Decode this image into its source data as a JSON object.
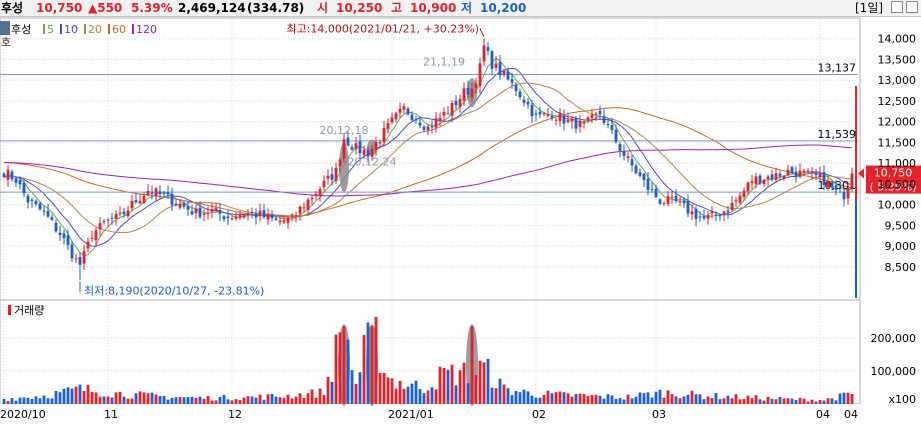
{
  "header": {
    "name": "후성",
    "price": "10,750",
    "change": "▲550",
    "change_pct": "5.39%",
    "volume": "2,469,124",
    "amount": "(334.78)",
    "open_label": "시",
    "open": "10,250",
    "high_label": "고",
    "high": "10,900",
    "low_label": "저",
    "low": "10,200",
    "period": "[1일]"
  },
  "colors": {
    "up": "#e8202a",
    "down": "#1a5fd6",
    "ma5": "#6aa84f",
    "ma10": "#4a4ad6",
    "ma20": "#b8864a",
    "ma60": "#d2691e",
    "ma120": "#a020c0",
    "grid": "#d8d8d8",
    "hline": "#7f96c8",
    "highlight": "#8c8c8c"
  },
  "legend": {
    "ticker": "후성",
    "items": [
      {
        "label": "5",
        "color": "#6aa84f"
      },
      {
        "label": "10",
        "color": "#4a4ad6"
      },
      {
        "label": "20",
        "color": "#b8864a"
      },
      {
        "label": "60",
        "color": "#d2691e"
      },
      {
        "label": "120",
        "color": "#a020c0"
      }
    ]
  },
  "left_tab": "호",
  "volume_title": "거래량",
  "chart_data": {
    "type": "candlestick",
    "price_ticks": [
      "14,000",
      "13,500",
      "13,000",
      "12,500",
      "12,000",
      "11,500",
      "11,000",
      "10,500",
      "10,000",
      "9,500",
      "9,000",
      "8,500"
    ],
    "price_tick_values": [
      14000,
      13500,
      13000,
      12500,
      12000,
      11500,
      11000,
      10500,
      10000,
      9500,
      9000,
      8500
    ],
    "ylim": [
      7750,
      14500
    ],
    "volume_ticks": [
      "200,000",
      "100,000",
      "x100"
    ],
    "volume_tick_values": [
      200000,
      100000
    ],
    "volume_ylim": [
      0,
      260000
    ],
    "x_ticks": [
      "2020/10",
      "11",
      "12",
      "2021/01",
      "02",
      "03",
      "04",
      "04"
    ],
    "x_tick_index": [
      0,
      26,
      57,
      97,
      133,
      163,
      204,
      212
    ],
    "n_days": 213,
    "hlines": [
      13137,
      11539,
      10301
    ],
    "hline_labels": [
      "13,137",
      "11,539",
      "10,301"
    ],
    "current_price": 10750,
    "current_label": "10,750",
    "current_pct_label": "( 5.39%)",
    "high_annotation": "최고:14,000(2021/01/21, +30.23%)",
    "low_annotation": "최저:8,190(2020/10/27, -23.81%)",
    "high_point": {
      "index": 120,
      "price": 14000
    },
    "low_point": {
      "index": 19,
      "price": 8190
    },
    "date_labels": [
      {
        "text": "20,12,18",
        "index": 85,
        "price": 11700
      },
      {
        "text": "20,12,24",
        "index": 92,
        "price": 10950
      },
      {
        "text": "21,1,19",
        "index": 110,
        "price": 13350
      }
    ],
    "highlights": [
      {
        "index": 85,
        "price_top": 11500,
        "price_bottom": 10300
      },
      {
        "index": 92,
        "price_top": 11550,
        "price_bottom": 11200
      },
      {
        "index": 117,
        "price_top": 13050,
        "price_bottom": 12350
      }
    ],
    "volume_highlights": [
      85,
      92,
      117
    ],
    "anchors": [
      [
        0,
        10800
      ],
      [
        3,
        10600
      ],
      [
        6,
        10100
      ],
      [
        10,
        9800
      ],
      [
        14,
        9300
      ],
      [
        19,
        8500
      ],
      [
        22,
        9300
      ],
      [
        26,
        9600
      ],
      [
        29,
        9700
      ],
      [
        33,
        10100
      ],
      [
        36,
        10350
      ],
      [
        40,
        10200
      ],
      [
        44,
        10000
      ],
      [
        48,
        9800
      ],
      [
        52,
        9850
      ],
      [
        56,
        9700
      ],
      [
        60,
        9800
      ],
      [
        64,
        9750
      ],
      [
        68,
        9600
      ],
      [
        72,
        9650
      ],
      [
        74,
        9900
      ],
      [
        77,
        10200
      ],
      [
        80,
        10500
      ],
      [
        83,
        10800
      ],
      [
        85,
        11600
      ],
      [
        88,
        11350
      ],
      [
        91,
        11250
      ],
      [
        94,
        11600
      ],
      [
        97,
        12000
      ],
      [
        100,
        12300
      ],
      [
        103,
        12100
      ],
      [
        106,
        11850
      ],
      [
        109,
        12100
      ],
      [
        112,
        12350
      ],
      [
        115,
        12700
      ],
      [
        117,
        12800
      ],
      [
        119,
        13300
      ],
      [
        120,
        13800
      ],
      [
        122,
        13400
      ],
      [
        125,
        13100
      ],
      [
        128,
        12800
      ],
      [
        131,
        12400
      ],
      [
        133,
        12100
      ],
      [
        137,
        12200
      ],
      [
        141,
        12000
      ],
      [
        145,
        11900
      ],
      [
        149,
        12200
      ],
      [
        152,
        11700
      ],
      [
        155,
        11200
      ],
      [
        158,
        10800
      ],
      [
        161,
        10400
      ],
      [
        164,
        10100
      ],
      [
        168,
        10050
      ],
      [
        172,
        9800
      ],
      [
        175,
        9650
      ],
      [
        178,
        9750
      ],
      [
        181,
        9900
      ],
      [
        184,
        10200
      ],
      [
        187,
        10600
      ],
      [
        190,
        10650
      ],
      [
        193,
        10700
      ],
      [
        196,
        10800
      ],
      [
        199,
        10750
      ],
      [
        202,
        10700
      ],
      [
        205,
        10600
      ],
      [
        208,
        10300
      ],
      [
        210,
        10250
      ],
      [
        212,
        10750
      ]
    ],
    "volume_anchors": [
      [
        0,
        15000
      ],
      [
        10,
        25000
      ],
      [
        19,
        45000
      ],
      [
        30,
        30000
      ],
      [
        40,
        22000
      ],
      [
        50,
        18000
      ],
      [
        60,
        20000
      ],
      [
        70,
        24000
      ],
      [
        80,
        35000
      ],
      [
        85,
        235000
      ],
      [
        88,
        60000
      ],
      [
        92,
        235000
      ],
      [
        96,
        80000
      ],
      [
        100,
        60000
      ],
      [
        105,
        50000
      ],
      [
        110,
        90000
      ],
      [
        117,
        95000
      ],
      [
        120,
        110000
      ],
      [
        125,
        45000
      ],
      [
        133,
        30000
      ],
      [
        145,
        25000
      ],
      [
        155,
        20000
      ],
      [
        165,
        35000
      ],
      [
        175,
        25000
      ],
      [
        185,
        20000
      ],
      [
        195,
        15000
      ],
      [
        205,
        12000
      ],
      [
        212,
        30000
      ]
    ]
  }
}
